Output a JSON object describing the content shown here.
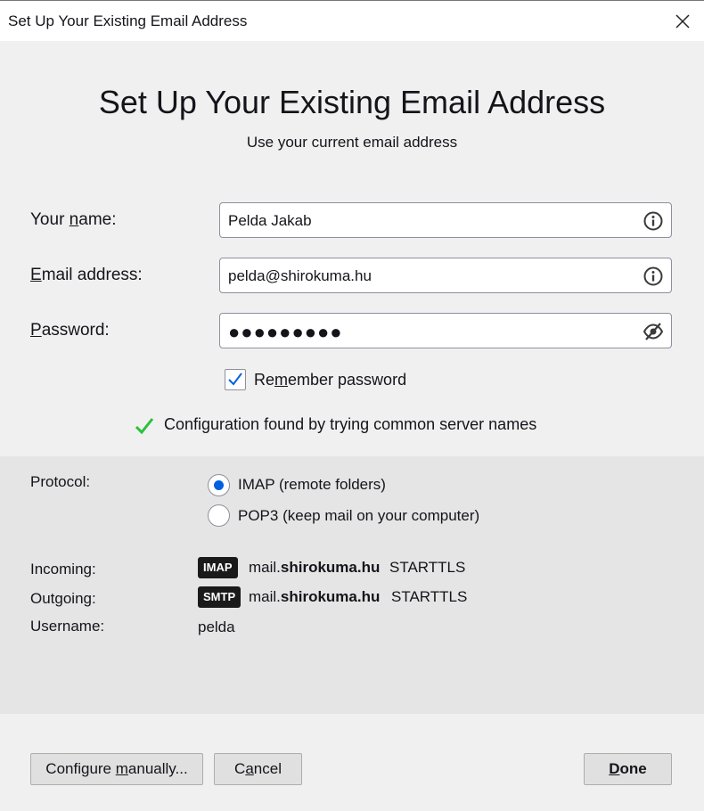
{
  "window": {
    "title": "Set Up Your Existing Email Address",
    "close_icon": "close-icon"
  },
  "heading": "Set Up Your Existing Email Address",
  "subheading": "Use your current email address",
  "form": {
    "name": {
      "label_pre": "Your ",
      "label_u": "n",
      "label_post": "ame:",
      "value": "Pelda Jakab",
      "icon": "info-icon"
    },
    "email": {
      "label_pre": "",
      "label_u": "E",
      "label_post": "mail address:",
      "value": "pelda@shirokuma.hu",
      "icon": "info-icon"
    },
    "password": {
      "label_pre": "",
      "label_u": "P",
      "label_post": "assword:",
      "value": "●●●●●●●●●",
      "icon": "eye-slash-icon"
    },
    "remember": {
      "checked": true,
      "label_pre": "Re",
      "label_u": "m",
      "label_post": "ember password"
    }
  },
  "status": {
    "icon": "checkmark-icon",
    "text": "Configuration found by trying common server names",
    "color": "#2ac13a"
  },
  "config": {
    "protocol_label": "Protocol:",
    "protocols": [
      {
        "label": "IMAP (remote folders)",
        "selected": true
      },
      {
        "label": "POP3 (keep mail on your computer)",
        "selected": false
      }
    ],
    "incoming": {
      "label": "Incoming:",
      "badge": "IMAP",
      "host_prefix": "mail.",
      "host_bold": "shirokuma.hu",
      "security": "STARTTLS"
    },
    "outgoing": {
      "label": "Outgoing:",
      "badge": "SMTP",
      "host_prefix": "mail.",
      "host_bold": "shirokuma.hu",
      "security": "STARTTLS"
    },
    "username": {
      "label": "Username:",
      "value": "pelda"
    }
  },
  "buttons": {
    "configure": {
      "pre": "Configure ",
      "u": "m",
      "post": "anually..."
    },
    "cancel": {
      "pre": "C",
      "u": "a",
      "post": "ncel"
    },
    "done": {
      "pre": "",
      "u": "D",
      "post": "one"
    }
  },
  "colors": {
    "accent": "#0061e0",
    "success": "#2ac13a",
    "badge_bg": "#1a1a1a"
  }
}
